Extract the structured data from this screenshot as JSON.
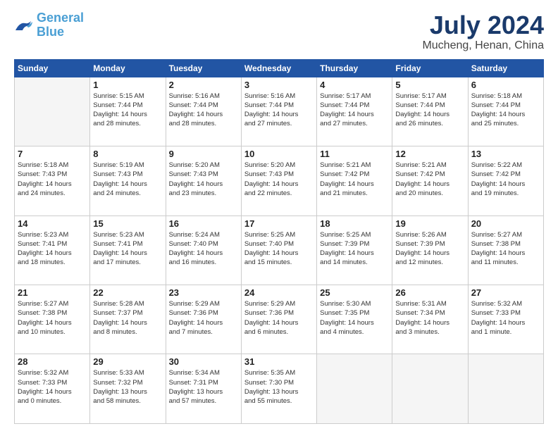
{
  "header": {
    "logo_line1": "General",
    "logo_line2": "Blue",
    "main_title": "July 2024",
    "subtitle": "Mucheng, Henan, China"
  },
  "weekdays": [
    "Sunday",
    "Monday",
    "Tuesday",
    "Wednesday",
    "Thursday",
    "Friday",
    "Saturday"
  ],
  "weeks": [
    [
      {
        "day": "",
        "empty": true
      },
      {
        "day": "1",
        "sunrise": "5:15 AM",
        "sunset": "7:44 PM",
        "daylight": "14 hours and 28 minutes."
      },
      {
        "day": "2",
        "sunrise": "5:16 AM",
        "sunset": "7:44 PM",
        "daylight": "14 hours and 28 minutes."
      },
      {
        "day": "3",
        "sunrise": "5:16 AM",
        "sunset": "7:44 PM",
        "daylight": "14 hours and 27 minutes."
      },
      {
        "day": "4",
        "sunrise": "5:17 AM",
        "sunset": "7:44 PM",
        "daylight": "14 hours and 27 minutes."
      },
      {
        "day": "5",
        "sunrise": "5:17 AM",
        "sunset": "7:44 PM",
        "daylight": "14 hours and 26 minutes."
      },
      {
        "day": "6",
        "sunrise": "5:18 AM",
        "sunset": "7:44 PM",
        "daylight": "14 hours and 25 minutes."
      }
    ],
    [
      {
        "day": "7",
        "sunrise": "5:18 AM",
        "sunset": "7:43 PM",
        "daylight": "14 hours and 24 minutes."
      },
      {
        "day": "8",
        "sunrise": "5:19 AM",
        "sunset": "7:43 PM",
        "daylight": "14 hours and 24 minutes."
      },
      {
        "day": "9",
        "sunrise": "5:20 AM",
        "sunset": "7:43 PM",
        "daylight": "14 hours and 23 minutes."
      },
      {
        "day": "10",
        "sunrise": "5:20 AM",
        "sunset": "7:43 PM",
        "daylight": "14 hours and 22 minutes."
      },
      {
        "day": "11",
        "sunrise": "5:21 AM",
        "sunset": "7:42 PM",
        "daylight": "14 hours and 21 minutes."
      },
      {
        "day": "12",
        "sunrise": "5:21 AM",
        "sunset": "7:42 PM",
        "daylight": "14 hours and 20 minutes."
      },
      {
        "day": "13",
        "sunrise": "5:22 AM",
        "sunset": "7:42 PM",
        "daylight": "14 hours and 19 minutes."
      }
    ],
    [
      {
        "day": "14",
        "sunrise": "5:23 AM",
        "sunset": "7:41 PM",
        "daylight": "14 hours and 18 minutes."
      },
      {
        "day": "15",
        "sunrise": "5:23 AM",
        "sunset": "7:41 PM",
        "daylight": "14 hours and 17 minutes."
      },
      {
        "day": "16",
        "sunrise": "5:24 AM",
        "sunset": "7:40 PM",
        "daylight": "14 hours and 16 minutes."
      },
      {
        "day": "17",
        "sunrise": "5:25 AM",
        "sunset": "7:40 PM",
        "daylight": "14 hours and 15 minutes."
      },
      {
        "day": "18",
        "sunrise": "5:25 AM",
        "sunset": "7:39 PM",
        "daylight": "14 hours and 14 minutes."
      },
      {
        "day": "19",
        "sunrise": "5:26 AM",
        "sunset": "7:39 PM",
        "daylight": "14 hours and 12 minutes."
      },
      {
        "day": "20",
        "sunrise": "5:27 AM",
        "sunset": "7:38 PM",
        "daylight": "14 hours and 11 minutes."
      }
    ],
    [
      {
        "day": "21",
        "sunrise": "5:27 AM",
        "sunset": "7:38 PM",
        "daylight": "14 hours and 10 minutes."
      },
      {
        "day": "22",
        "sunrise": "5:28 AM",
        "sunset": "7:37 PM",
        "daylight": "14 hours and 8 minutes."
      },
      {
        "day": "23",
        "sunrise": "5:29 AM",
        "sunset": "7:36 PM",
        "daylight": "14 hours and 7 minutes."
      },
      {
        "day": "24",
        "sunrise": "5:29 AM",
        "sunset": "7:36 PM",
        "daylight": "14 hours and 6 minutes."
      },
      {
        "day": "25",
        "sunrise": "5:30 AM",
        "sunset": "7:35 PM",
        "daylight": "14 hours and 4 minutes."
      },
      {
        "day": "26",
        "sunrise": "5:31 AM",
        "sunset": "7:34 PM",
        "daylight": "14 hours and 3 minutes."
      },
      {
        "day": "27",
        "sunrise": "5:32 AM",
        "sunset": "7:33 PM",
        "daylight": "14 hours and 1 minute."
      }
    ],
    [
      {
        "day": "28",
        "sunrise": "5:32 AM",
        "sunset": "7:33 PM",
        "daylight": "14 hours and 0 minutes."
      },
      {
        "day": "29",
        "sunrise": "5:33 AM",
        "sunset": "7:32 PM",
        "daylight": "13 hours and 58 minutes."
      },
      {
        "day": "30",
        "sunrise": "5:34 AM",
        "sunset": "7:31 PM",
        "daylight": "13 hours and 57 minutes."
      },
      {
        "day": "31",
        "sunrise": "5:35 AM",
        "sunset": "7:30 PM",
        "daylight": "13 hours and 55 minutes."
      },
      {
        "day": "",
        "empty": true
      },
      {
        "day": "",
        "empty": true
      },
      {
        "day": "",
        "empty": true
      }
    ]
  ]
}
